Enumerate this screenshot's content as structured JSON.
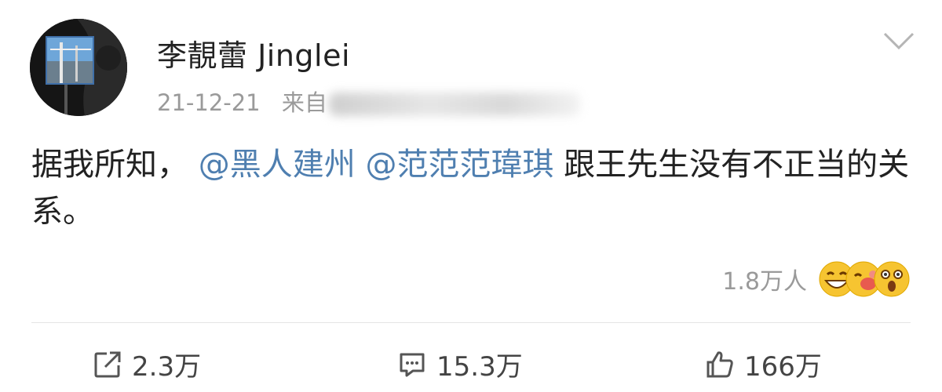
{
  "post": {
    "username": "李靚蕾 Jinglei",
    "date": "21-12-21",
    "source_prefix": "来自",
    "text_parts": {
      "intro": "据我所知，",
      "mention1": "@黑人建州",
      "mention2": "@范范范瑋琪",
      "rest": " 跟王先生没有不正当的关系。"
    },
    "reaction_count": "1.8万人",
    "reaction_icons": [
      "grin-emoji",
      "kiss-emoji",
      "surprised-emoji"
    ]
  },
  "actions": {
    "repost": {
      "icon": "share-icon",
      "count": "2.3万"
    },
    "comment": {
      "icon": "comment-icon",
      "count": "15.3万"
    },
    "like": {
      "icon": "thumbs-up-icon",
      "count": "166万"
    }
  },
  "colors": {
    "mention": "#4f7fb0",
    "meta": "#9a9a9a",
    "text": "#222222"
  }
}
